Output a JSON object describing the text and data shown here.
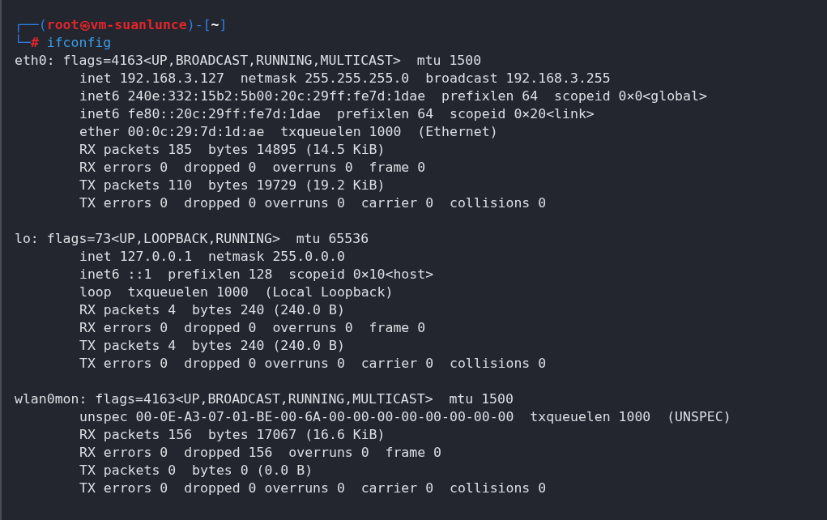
{
  "prompt": {
    "corner_top": "┌──(",
    "user": "root",
    "at": "㉿",
    "host": "vm-suanlunce",
    "bracket_open": ")-[",
    "dir": "~",
    "bracket_close": "]",
    "corner_bottom": "└─",
    "symbol": "#",
    "command": "ifconfig"
  },
  "interfaces": [
    {
      "header": "eth0: flags=4163<UP,BROADCAST,RUNNING,MULTICAST>  mtu 1500",
      "lines": [
        "inet 192.168.3.127  netmask 255.255.255.0  broadcast 192.168.3.255",
        "inet6 240e:332:15b2:5b00:20c:29ff:fe7d:1dae  prefixlen 64  scopeid 0×0<global>",
        "inet6 fe80::20c:29ff:fe7d:1dae  prefixlen 64  scopeid 0×20<link>",
        "ether 00:0c:29:7d:1d:ae  txqueuelen 1000  (Ethernet)",
        "RX packets 185  bytes 14895 (14.5 KiB)",
        "RX errors 0  dropped 0  overruns 0  frame 0",
        "TX packets 110  bytes 19729 (19.2 KiB)",
        "TX errors 0  dropped 0 overruns 0  carrier 0  collisions 0"
      ]
    },
    {
      "header": "lo: flags=73<UP,LOOPBACK,RUNNING>  mtu 65536",
      "lines": [
        "inet 127.0.0.1  netmask 255.0.0.0",
        "inet6 ::1  prefixlen 128  scopeid 0×10<host>",
        "loop  txqueuelen 1000  (Local Loopback)",
        "RX packets 4  bytes 240 (240.0 B)",
        "RX errors 0  dropped 0  overruns 0  frame 0",
        "TX packets 4  bytes 240 (240.0 B)",
        "TX errors 0  dropped 0 overruns 0  carrier 0  collisions 0"
      ]
    },
    {
      "header": "wlan0mon: flags=4163<UP,BROADCAST,RUNNING,MULTICAST>  mtu 1500",
      "lines": [
        "unspec 00-0E-A3-07-01-BE-00-6A-00-00-00-00-00-00-00-00  txqueuelen 1000  (UNSPEC)",
        "RX packets 156  bytes 17067 (16.6 KiB)",
        "RX errors 0  dropped 156  overruns 0  frame 0",
        "TX packets 0  bytes 0 (0.0 B)",
        "TX errors 0  dropped 0 overruns 0  carrier 0  collisions 0"
      ]
    }
  ]
}
